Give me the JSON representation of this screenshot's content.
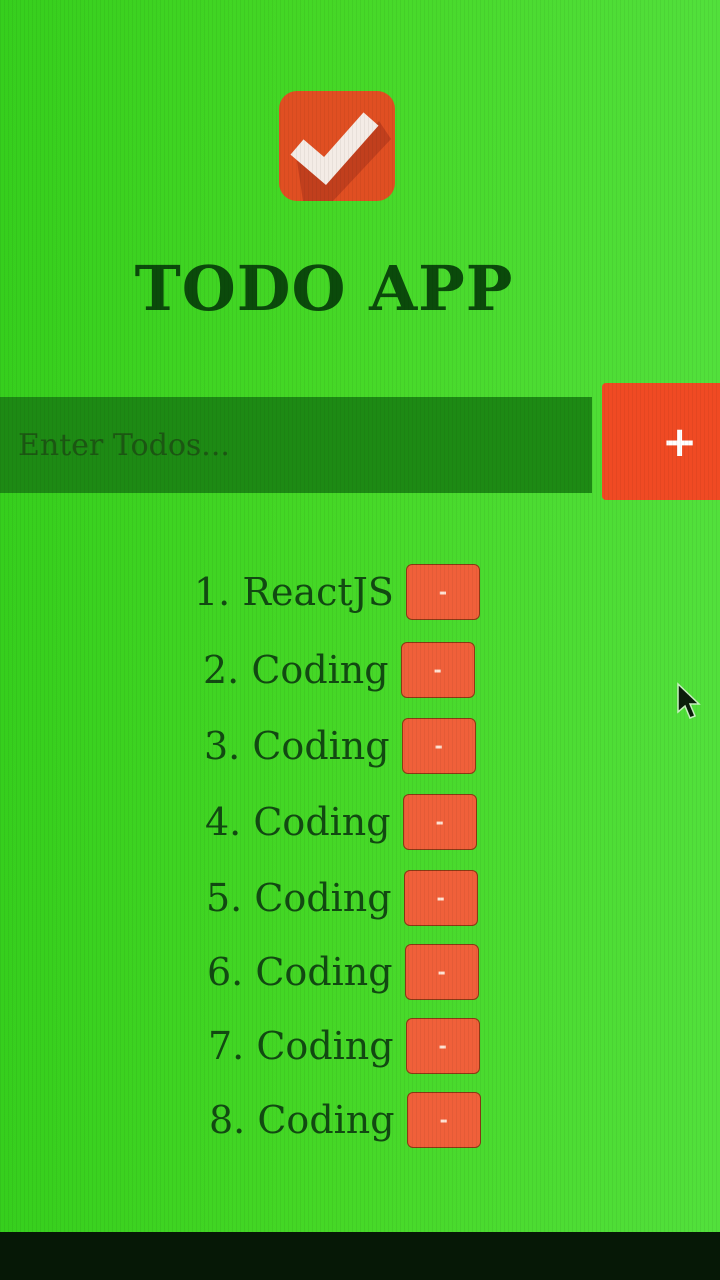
{
  "app": {
    "title": "TODO APP",
    "logo_icon": "checkmark-icon",
    "accent_color": "#f04a23",
    "background_color": "#3dd22a"
  },
  "input": {
    "placeholder": "Enter Todos...",
    "value": ""
  },
  "add_button": {
    "label": "+"
  },
  "todos": [
    {
      "number": "1.",
      "text": "ReactJS",
      "remove_label": "-"
    },
    {
      "number": "2.",
      "text": "Coding",
      "remove_label": "-"
    },
    {
      "number": "3.",
      "text": "Coding",
      "remove_label": "-"
    },
    {
      "number": "4.",
      "text": "Coding",
      "remove_label": "-"
    },
    {
      "number": "5.",
      "text": "Coding",
      "remove_label": "-"
    },
    {
      "number": "6.",
      "text": "Coding",
      "remove_label": "-"
    },
    {
      "number": "7.",
      "text": "Coding",
      "remove_label": "-"
    },
    {
      "number": "8.",
      "text": "Coding",
      "remove_label": "-"
    }
  ]
}
